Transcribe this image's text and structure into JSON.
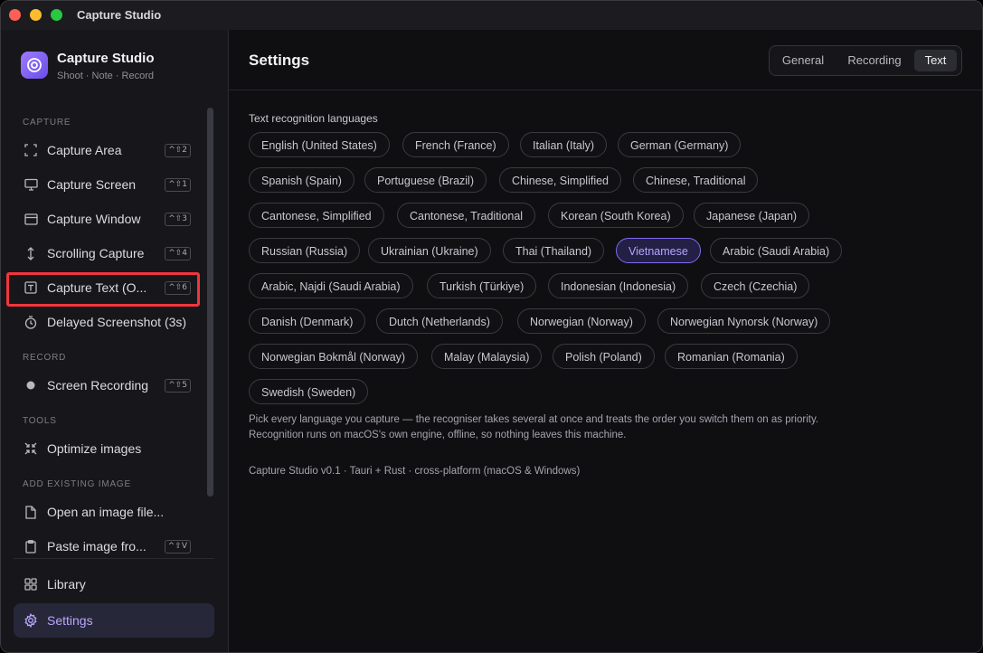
{
  "window": {
    "title": "Capture Studio"
  },
  "brand": {
    "name": "Capture Studio",
    "subtitle": "Shoot · Note · Record"
  },
  "sidebar": {
    "sections": {
      "capture": "CAPTURE",
      "record": "RECORD",
      "tools": "TOOLS",
      "add_existing": "ADD EXISTING IMAGE"
    },
    "capture_items": [
      {
        "label": "Capture Area",
        "shortcut": "^⇧2",
        "icon": "area-icon"
      },
      {
        "label": "Capture Screen",
        "shortcut": "^⇧1",
        "icon": "monitor-icon"
      },
      {
        "label": "Capture Window",
        "shortcut": "^⇧3",
        "icon": "window-icon"
      },
      {
        "label": "Scrolling Capture",
        "shortcut": "^⇧4",
        "icon": "scroll-icon"
      },
      {
        "label": "Capture Text (O...",
        "shortcut": "^⇧6",
        "icon": "text-icon"
      },
      {
        "label": "Delayed Screenshot (3s)",
        "shortcut": "",
        "icon": "timer-icon"
      }
    ],
    "record_items": [
      {
        "label": "Screen Recording",
        "shortcut": "^⇧5",
        "icon": "record-dot-icon"
      }
    ],
    "tools_items": [
      {
        "label": "Optimize images",
        "icon": "compress-icon"
      }
    ],
    "add_items": [
      {
        "label": "Open an image file...",
        "icon": "file-icon"
      },
      {
        "label": "Paste image fro...",
        "shortcut": "^⇧V",
        "icon": "clipboard-icon"
      }
    ],
    "bottom_items": [
      {
        "label": "Library",
        "icon": "grid-icon"
      },
      {
        "label": "Settings",
        "icon": "gear-icon",
        "active": true
      }
    ]
  },
  "main": {
    "title": "Settings",
    "tabs": [
      {
        "label": "General",
        "active": false
      },
      {
        "label": "Recording",
        "active": false
      },
      {
        "label": "Text",
        "active": true
      }
    ],
    "languages_heading": "Text recognition languages",
    "languages": [
      {
        "label": "English (United States)",
        "selected": false
      },
      {
        "label": "French (France)",
        "selected": false
      },
      {
        "label": "Italian (Italy)",
        "selected": false
      },
      {
        "label": "German (Germany)",
        "selected": false
      },
      {
        "label": "Spanish (Spain)",
        "selected": false
      },
      {
        "label": "Portuguese (Brazil)",
        "selected": false
      },
      {
        "label": "Chinese, Simplified",
        "selected": false
      },
      {
        "label": "Chinese, Traditional",
        "selected": false
      },
      {
        "label": "Cantonese, Simplified",
        "selected": false
      },
      {
        "label": "Cantonese, Traditional",
        "selected": false
      },
      {
        "label": "Korean (South Korea)",
        "selected": false
      },
      {
        "label": "Japanese (Japan)",
        "selected": false
      },
      {
        "label": "Russian (Russia)",
        "selected": false
      },
      {
        "label": "Ukrainian (Ukraine)",
        "selected": false
      },
      {
        "label": "Thai (Thailand)",
        "selected": false
      },
      {
        "label": "Vietnamese",
        "selected": true
      },
      {
        "label": "Arabic (Saudi Arabia)",
        "selected": false
      },
      {
        "label": "Arabic, Najdi (Saudi Arabia)",
        "selected": false
      },
      {
        "label": "Turkish (Türkiye)",
        "selected": false
      },
      {
        "label": "Indonesian (Indonesia)",
        "selected": false
      },
      {
        "label": "Czech (Czechia)",
        "selected": false
      },
      {
        "label": "Danish (Denmark)",
        "selected": false
      },
      {
        "label": "Dutch (Netherlands)",
        "selected": false
      },
      {
        "label": "Norwegian (Norway)",
        "selected": false
      },
      {
        "label": "Norwegian Nynorsk (Norway)",
        "selected": false
      },
      {
        "label": "Norwegian Bokmål (Norway)",
        "selected": false
      },
      {
        "label": "Malay (Malaysia)",
        "selected": false
      },
      {
        "label": "Polish (Poland)",
        "selected": false
      },
      {
        "label": "Romanian (Romania)",
        "selected": false
      },
      {
        "label": "Swedish (Sweden)",
        "selected": false
      }
    ],
    "help_line1": "Pick every language you capture — the recogniser takes several at once and treats the order you switch them on as priority.",
    "help_line2": "Recognition runs on macOS's own engine, offline, so nothing leaves this machine.",
    "version_note": "Capture Studio v0.1 · Tauri + Rust · cross-platform (macOS & Windows)"
  },
  "colors": {
    "accent": "#9d7bff",
    "highlight": "#f0353d",
    "selected_chip": "#7d6cf0"
  }
}
